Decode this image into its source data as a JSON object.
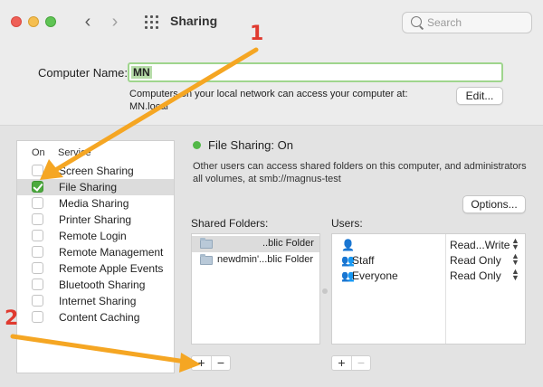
{
  "window": {
    "title": "Sharing",
    "traffic_colors": {
      "close": "#ee5f57",
      "minimize": "#f5be4f",
      "zoom": "#5fc454"
    },
    "back_icon": "‹",
    "forward_icon": "›",
    "search_placeholder": "Search"
  },
  "computer_name": {
    "label": "Computer Name:",
    "value": "MN",
    "description_line1": "Computers on your local network can access your computer at:",
    "description_line2": "MN.local",
    "edit_label": "Edit..."
  },
  "services": {
    "header_on": "On",
    "header_service": "Service",
    "items": [
      {
        "label": "Screen Sharing",
        "checked": false,
        "selected": false
      },
      {
        "label": "File Sharing",
        "checked": true,
        "selected": true
      },
      {
        "label": "Media Sharing",
        "checked": false,
        "selected": false
      },
      {
        "label": "Printer Sharing",
        "checked": false,
        "selected": false
      },
      {
        "label": "Remote Login",
        "checked": false,
        "selected": false
      },
      {
        "label": "Remote Management",
        "checked": false,
        "selected": false
      },
      {
        "label": "Remote Apple Events",
        "checked": false,
        "selected": false
      },
      {
        "label": "Bluetooth Sharing",
        "checked": false,
        "selected": false
      },
      {
        "label": "Internet Sharing",
        "checked": false,
        "selected": false
      },
      {
        "label": "Content Caching",
        "checked": false,
        "selected": false
      }
    ]
  },
  "status": {
    "title": "File Sharing: On",
    "color": "#52b847",
    "description_line1": "Other users can access shared folders on this computer, and administrators",
    "description_line2": "all volumes, at smb://magnus-test",
    "options_label": "Options..."
  },
  "shared_folders": {
    "label": "Shared Folders:",
    "items": [
      {
        "name": "..blic Folder",
        "selected": true
      },
      {
        "name": "newdmin'...blic Folder",
        "selected": false
      }
    ],
    "add_label": "+",
    "remove_label": "−"
  },
  "users": {
    "label": "Users:",
    "items": [
      {
        "icon": "single-user-icon",
        "glyph": "👤",
        "name": "",
        "permission": "Read...Write"
      },
      {
        "icon": "group-icon",
        "glyph": "👥",
        "name": "Staff",
        "permission": "Read Only"
      },
      {
        "icon": "group-icon",
        "glyph": "👥",
        "name": "Everyone",
        "permission": "Read Only"
      }
    ],
    "add_label": "+",
    "remove_label": "−"
  },
  "annotations": {
    "marker_1": "1",
    "marker_2": "2",
    "arrow_color": "#f5a623",
    "number_color": "#e03a2f"
  }
}
